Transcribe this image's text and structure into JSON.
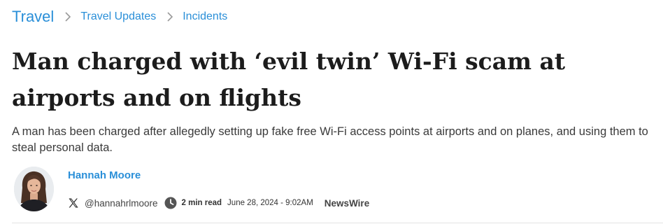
{
  "breadcrumb": {
    "section": "Travel",
    "items": [
      "Travel Updates",
      "Incidents"
    ]
  },
  "article": {
    "headline": "Man charged with ‘evil twin’ Wi-Fi scam at airports and on flights",
    "standfirst": "A man has been charged after allegedly setting up fake free Wi-Fi access points at airports and on planes, and using them to steal personal data."
  },
  "author": {
    "name": "Hannah Moore",
    "handle": "@hannahrlmoore"
  },
  "meta": {
    "read_time": "2 min read",
    "date": "June 28, 2024 - 9:02AM",
    "source": "NewsWire"
  },
  "icons": {
    "separator": "chevron-right-icon",
    "social": "x-logo-icon",
    "time": "clock-icon"
  },
  "colors": {
    "accent": "#2a8fd8",
    "headline": "#1c1c1c",
    "body": "#3a3a3a",
    "meta": "#333333"
  }
}
